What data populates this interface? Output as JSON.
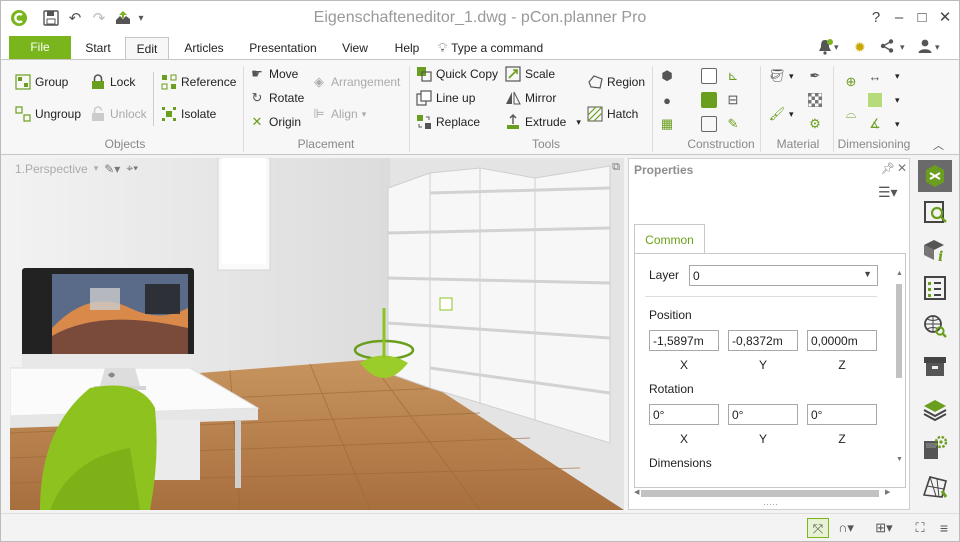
{
  "titlebar": {
    "title": "Eigenschafteneditor_1.dwg - pCon.planner Pro",
    "app_logo_icon": "pcon-logo-icon",
    "quick_access": [
      "save-icon",
      "undo-icon",
      "redo-icon",
      "publish-icon",
      "dropdown-icon"
    ],
    "window_buttons": [
      "?",
      "–",
      "□",
      "✕"
    ]
  },
  "tabs": {
    "file": "File",
    "items": [
      "Start",
      "Edit",
      "Articles",
      "Presentation",
      "View",
      "Help"
    ],
    "active": "Edit",
    "command": "Type a command"
  },
  "ribbon": {
    "objects": {
      "label": "Objects",
      "group": "Group",
      "ungroup": "Ungroup",
      "lock": "Lock",
      "unlock": "Unlock",
      "reference": "Reference",
      "isolate": "Isolate"
    },
    "placement": {
      "label": "Placement",
      "move": "Move",
      "rotate": "Rotate",
      "origin": "Origin",
      "arrangement": "Arrangement",
      "align": "Align"
    },
    "tools": {
      "label": "Tools",
      "quick_copy": "Quick Copy",
      "line_up": "Line up",
      "replace": "Replace",
      "scale": "Scale",
      "mirror": "Mirror",
      "extrude": "Extrude",
      "region": "Region",
      "hatch": "Hatch"
    },
    "construction": {
      "label": "Construction"
    },
    "material": {
      "label": "Material"
    },
    "dimensioning": {
      "label": "Dimensioning"
    }
  },
  "viewport": {
    "view_label": "1.Perspective"
  },
  "properties": {
    "title": "Properties",
    "tab": "Common",
    "layer_label": "Layer",
    "layer_value": "0",
    "position_label": "Position",
    "position": {
      "x": "-1,5897m",
      "y": "-0,8372m",
      "z": "0,0000m"
    },
    "rotation_label": "Rotation",
    "rotation": {
      "x": "0°",
      "y": "0°",
      "z": "0°"
    },
    "axes": {
      "x": "X",
      "y": "Y",
      "z": "Z"
    },
    "dimensions_label": "Dimensions"
  },
  "colors": {
    "accent": "#7ab51d",
    "accent_text": "#6aa21a",
    "floor": "#c8925a",
    "chair": "#8ec31f"
  }
}
